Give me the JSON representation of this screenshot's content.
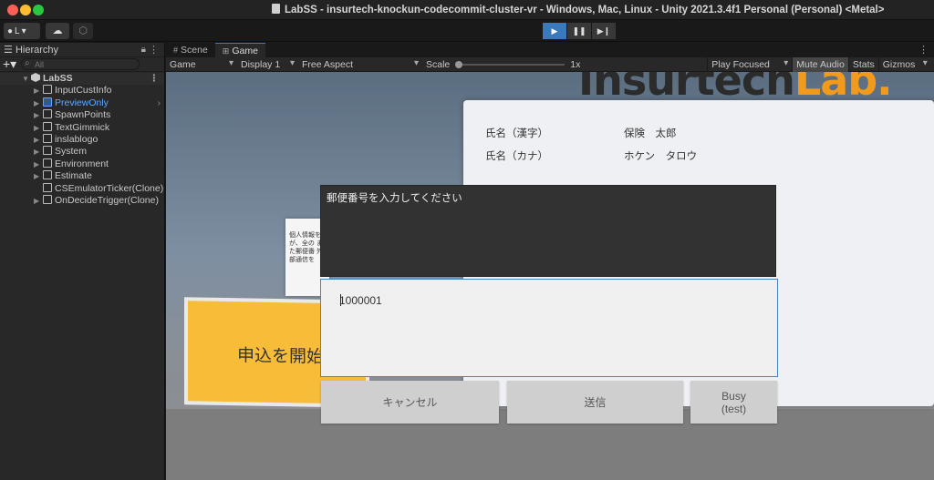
{
  "window": {
    "title": "LabSS - insurtech-knockun-codecommit-cluster-vr - Windows, Mac, Linux - Unity 2021.3.4f1 Personal (Personal) <Metal>"
  },
  "toolbar": {
    "account_label": "L"
  },
  "hierarchy": {
    "tab_label": "Hierarchy",
    "search_placeholder": "All",
    "root": "LabSS",
    "items": [
      {
        "label": "InputCustInfo"
      },
      {
        "label": "PreviewOnly"
      },
      {
        "label": "SpawnPoints"
      },
      {
        "label": "TextGimmick"
      },
      {
        "label": "inslablogo"
      },
      {
        "label": "System"
      },
      {
        "label": "Environment"
      },
      {
        "label": "Estimate"
      },
      {
        "label": "CSEmulatorTicker(Clone)"
      },
      {
        "label": "OnDecideTrigger(Clone)"
      }
    ]
  },
  "game_view": {
    "tabs": [
      {
        "label": "Scene"
      },
      {
        "label": "Game"
      }
    ],
    "bar": {
      "mode": "Game",
      "display": "Display 1",
      "aspect": "Free Aspect",
      "scale_label": "Scale",
      "scale_value": "1x",
      "play_focused": "Play Focused",
      "mute_audio": "Mute Audio",
      "stats": "Stats",
      "gizmos": "Gizmos"
    },
    "scene": {
      "logo_text_a": "Insurtech",
      "logo_text_b": "Lab.",
      "info_rows": [
        {
          "label": "氏名（漢字）",
          "value": "保険　太郎"
        },
        {
          "label": "氏名（カナ）",
          "value": "ホケン　タロウ"
        }
      ],
      "paper_text": "個人情報を が、全の また郵便番 外部通信を",
      "start_button": "申込を開始"
    },
    "dialog": {
      "message": "郵便番号を入力してください",
      "input_value": "1000001",
      "cancel_label": "キャンセル",
      "send_label": "送信",
      "busy_label": "Busy (test)"
    }
  }
}
